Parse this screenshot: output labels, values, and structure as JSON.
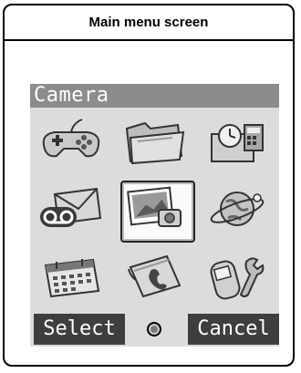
{
  "caption": "Main menu screen",
  "phone": {
    "title": "Camera",
    "menu_items": [
      {
        "icon": "gamepad-icon"
      },
      {
        "icon": "folder-icon"
      },
      {
        "icon": "clock-calculator-icon"
      },
      {
        "icon": "voicemail-icon"
      },
      {
        "icon": "camera-photos-icon",
        "selected": true
      },
      {
        "icon": "globe-browser-icon"
      },
      {
        "icon": "calendar-icon"
      },
      {
        "icon": "phonebook-icon"
      },
      {
        "icon": "phone-settings-icon"
      }
    ],
    "softkeys": {
      "left": "Select",
      "right": "Cancel"
    }
  }
}
